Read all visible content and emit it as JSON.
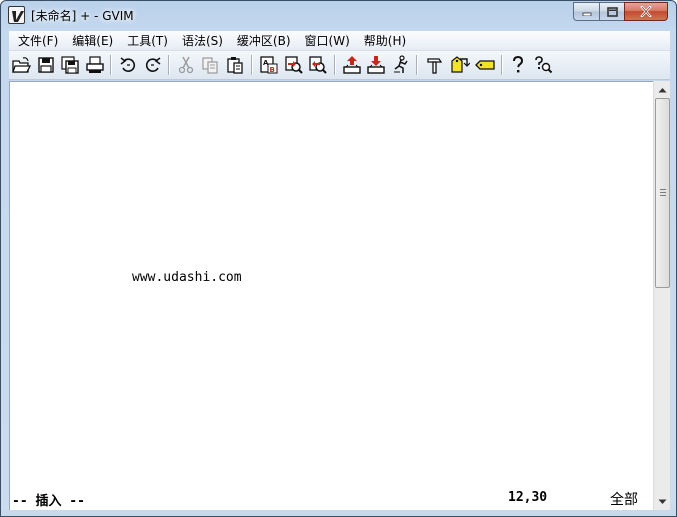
{
  "window": {
    "title": "[未命名] + - GVIM",
    "caption_buttons": [
      "minimize-icon",
      "maximize-icon",
      "close-icon"
    ]
  },
  "menu": {
    "items": [
      {
        "label": "文件(F)"
      },
      {
        "label": "编辑(E)"
      },
      {
        "label": "工具(T)"
      },
      {
        "label": "语法(S)"
      },
      {
        "label": "缓冲区(B)"
      },
      {
        "label": "窗口(W)"
      },
      {
        "label": "帮助(H)"
      }
    ]
  },
  "toolbar": {
    "buttons": [
      "open-icon",
      "save-icon",
      "save-all-icon",
      "print-icon",
      "undo-icon",
      "redo-icon",
      "cut-icon",
      "copy-icon",
      "paste-icon",
      "replace-icon",
      "find-next-icon",
      "find-prev-icon",
      "load-session-icon",
      "save-session-icon",
      "run-script-icon",
      "make-icon",
      "build-tags-icon",
      "jump-tag-icon",
      "help-icon",
      "find-help-icon"
    ]
  },
  "editor": {
    "line_text": "www.udashi.com"
  },
  "statusline": {
    "mode": "-- 插入 --",
    "position": "12,30",
    "scroll": "全部"
  },
  "colors": {
    "accent_red": "#c8261b",
    "yellow": "#f4e229"
  }
}
